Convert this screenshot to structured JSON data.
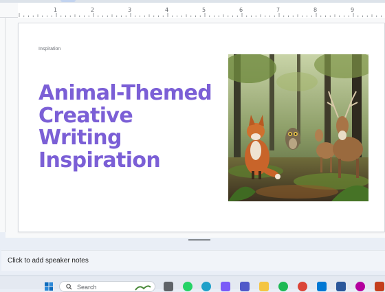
{
  "ruler": {
    "numbers": [
      "1",
      "2",
      "3",
      "4",
      "5",
      "6",
      "7",
      "8",
      "9"
    ]
  },
  "slide": {
    "label": "Inspiration",
    "title_lines": [
      "Animal-Themed",
      "Creative",
      "Writing",
      "Inspiration"
    ],
    "title_color": "#7b5fd6",
    "image_subject": "fox, owl and deer in a forest"
  },
  "notes": {
    "placeholder": "Click to add speaker notes"
  },
  "taskbar": {
    "search_placeholder": "Search",
    "icons": [
      "windows-start-icon",
      "search-icon",
      "task-view-icon",
      "whatsapp-icon",
      "edge-icon",
      "copilot-icon",
      "teams-icon",
      "file-explorer-icon",
      "spotify-icon",
      "chrome-icon",
      "microsoft-store-icon",
      "word-icon",
      "notifications-icon"
    ]
  }
}
